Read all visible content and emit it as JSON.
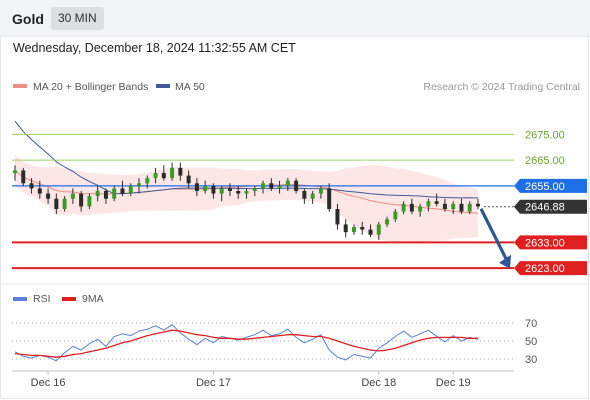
{
  "header": {
    "instrument": "Gold",
    "timeframe": "30 MIN",
    "timestamp": "Wednesday, December 18, 2024 11:32:55 AM CET"
  },
  "chart_data": [
    {
      "type": "line",
      "name": "price",
      "legend": [
        {
          "label": "MA 20 + Bollinger Bands",
          "color": "#f28b82"
        },
        {
          "label": "MA 50",
          "color": "#3d5a99"
        }
      ],
      "credit": "Research © 2024 Trading Central",
      "ylim": [
        2618,
        2688
      ],
      "y_ticks": [
        {
          "label": "2675.00",
          "value": 2675,
          "color": "#6aa32c"
        },
        {
          "label": "2665.00",
          "value": 2665,
          "color": "#6aa32c"
        },
        {
          "label": "2655.00",
          "value": 2655,
          "color": "#1e6ee8"
        },
        {
          "label": "2646.88",
          "value": 2646.88,
          "color": "#333333"
        },
        {
          "label": "2633.00",
          "value": 2633,
          "color": "#e02020"
        },
        {
          "label": "2623.00",
          "value": 2623,
          "color": "#e02020"
        }
      ],
      "levels": [
        {
          "role": "resistance",
          "value": 2675,
          "color": "#9bd162"
        },
        {
          "role": "resistance",
          "value": 2665,
          "color": "#9bd162"
        },
        {
          "role": "pivot",
          "value": 2655,
          "color": "#1e6ee8"
        },
        {
          "role": "last_price",
          "value": 2646.88,
          "color": "#555555"
        },
        {
          "role": "support",
          "value": 2633,
          "color": "#e02020"
        },
        {
          "role": "support",
          "value": 2623,
          "color": "#e02020"
        }
      ],
      "x_labels": [
        "Dec 16",
        "Dec 17",
        "Dec 18",
        "Dec 19"
      ],
      "x_label_positions": [
        4,
        24,
        44,
        53
      ],
      "candles_per_day": 20,
      "candles": [
        [
          2660,
          2663,
          2657,
          2661
        ],
        [
          2661,
          2662,
          2655,
          2656
        ],
        [
          2656,
          2658,
          2652,
          2654
        ],
        [
          2654,
          2657,
          2650,
          2652
        ],
        [
          2652,
          2654,
          2648,
          2650
        ],
        [
          2650,
          2652,
          2644,
          2646
        ],
        [
          2646,
          2651,
          2645,
          2650
        ],
        [
          2650,
          2654,
          2648,
          2652
        ],
        [
          2652,
          2653,
          2645,
          2647
        ],
        [
          2647,
          2652,
          2646,
          2651
        ],
        [
          2651,
          2655,
          2649,
          2653
        ],
        [
          2653,
          2654,
          2648,
          2650
        ],
        [
          2650,
          2655,
          2649,
          2654
        ],
        [
          2654,
          2657,
          2651,
          2652
        ],
        [
          2652,
          2656,
          2651,
          2655
        ],
        [
          2655,
          2658,
          2652,
          2656
        ],
        [
          2656,
          2659,
          2654,
          2658
        ],
        [
          2658,
          2662,
          2656,
          2660
        ],
        [
          2660,
          2663,
          2657,
          2658
        ],
        [
          2658,
          2664,
          2657,
          2662
        ],
        [
          2662,
          2664,
          2657,
          2659
        ],
        [
          2659,
          2661,
          2654,
          2656
        ],
        [
          2656,
          2658,
          2651,
          2653
        ],
        [
          2653,
          2657,
          2652,
          2655
        ],
        [
          2655,
          2656,
          2650,
          2652
        ],
        [
          2652,
          2655,
          2649,
          2654
        ],
        [
          2654,
          2656,
          2651,
          2653
        ],
        [
          2653,
          2655,
          2650,
          2652
        ],
        [
          2652,
          2654,
          2650,
          2653
        ],
        [
          2653,
          2655,
          2651,
          2654
        ],
        [
          2654,
          2657,
          2652,
          2656
        ],
        [
          2656,
          2658,
          2653,
          2654
        ],
        [
          2654,
          2657,
          2652,
          2655
        ],
        [
          2655,
          2658,
          2653,
          2657
        ],
        [
          2657,
          2658,
          2652,
          2653
        ],
        [
          2653,
          2654,
          2648,
          2650
        ],
        [
          2650,
          2653,
          2648,
          2652
        ],
        [
          2652,
          2655,
          2650,
          2654
        ],
        [
          2654,
          2656,
          2645,
          2646
        ],
        [
          2646,
          2648,
          2638,
          2640
        ],
        [
          2640,
          2642,
          2635,
          2637
        ],
        [
          2637,
          2640,
          2636,
          2639
        ],
        [
          2639,
          2641,
          2636,
          2638
        ],
        [
          2638,
          2640,
          2635,
          2636
        ],
        [
          2636,
          2641,
          2634,
          2640
        ],
        [
          2640,
          2643,
          2639,
          2642
        ],
        [
          2642,
          2646,
          2641,
          2645
        ],
        [
          2645,
          2649,
          2644,
          2648
        ],
        [
          2648,
          2650,
          2644,
          2645
        ],
        [
          2645,
          2648,
          2643,
          2647
        ],
        [
          2647,
          2650,
          2645,
          2649
        ],
        [
          2649,
          2652,
          2647,
          2648
        ],
        [
          2648,
          2650,
          2645,
          2646
        ],
        [
          2646,
          2649,
          2644,
          2648
        ],
        [
          2648,
          2650,
          2644,
          2645
        ],
        [
          2645,
          2649,
          2644,
          2648
        ],
        [
          2648,
          2650,
          2646,
          2647
        ]
      ]
    },
    {
      "type": "line",
      "name": "rsi",
      "legend": [
        {
          "label": "RSI",
          "color": "#5a7fd6"
        },
        {
          "label": "9MA",
          "color": "#e02020"
        }
      ],
      "ylim": [
        20,
        80
      ],
      "y_ticks": [
        70,
        50,
        30
      ],
      "series": [
        {
          "name": "RSI",
          "values": [
            38,
            33,
            31,
            34,
            32,
            28,
            37,
            44,
            40,
            47,
            52,
            44,
            55,
            58,
            56,
            61,
            63,
            67,
            62,
            68,
            59,
            52,
            46,
            53,
            48,
            55,
            53,
            51,
            54,
            57,
            62,
            56,
            58,
            63,
            54,
            48,
            52,
            57,
            40,
            32,
            29,
            35,
            33,
            31,
            42,
            48,
            55,
            61,
            54,
            58,
            62,
            55,
            49,
            56,
            50,
            54,
            52
          ]
        },
        {
          "name": "9MA",
          "values": [
            36,
            35,
            34,
            34,
            33,
            32,
            33,
            35,
            36,
            38,
            40,
            42,
            45,
            48,
            50,
            53,
            56,
            58,
            60,
            62,
            61,
            59,
            57,
            56,
            54,
            53,
            53,
            52,
            52,
            53,
            54,
            55,
            56,
            57,
            57,
            56,
            55,
            55,
            53,
            50,
            47,
            44,
            42,
            40,
            39,
            40,
            42,
            45,
            48,
            51,
            53,
            54,
            54,
            54,
            54,
            53,
            53
          ]
        }
      ]
    }
  ]
}
